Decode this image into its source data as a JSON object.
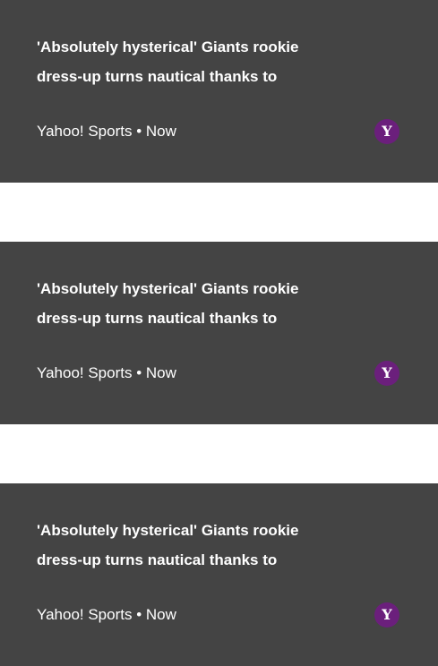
{
  "cards": [
    {
      "headline_line1": "'Absolutely hysterical' Giants rookie",
      "headline_line2": "dress-up turns nautical thanks to",
      "source": "Yahoo! Sports",
      "separator": "•",
      "time": "Now",
      "logo_icon": "yahoo-logo-icon",
      "logo_glyph": "Y"
    },
    {
      "headline_line1": "'Absolutely hysterical' Giants rookie",
      "headline_line2": "dress-up turns nautical thanks to",
      "source": "Yahoo! Sports",
      "separator": "•",
      "time": "Now",
      "logo_icon": "yahoo-logo-icon",
      "logo_glyph": "Y"
    },
    {
      "headline_line1": "'Absolutely hysterical' Giants rookie",
      "headline_line2": "dress-up turns nautical thanks to",
      "source": "Yahoo! Sports",
      "separator": "•",
      "time": "Now",
      "logo_icon": "yahoo-logo-icon",
      "logo_glyph": "Y"
    }
  ],
  "colors": {
    "card_background": "#444444",
    "text": "#ffffff",
    "logo_background": "#6b1f7c",
    "page_background": "#ffffff"
  }
}
